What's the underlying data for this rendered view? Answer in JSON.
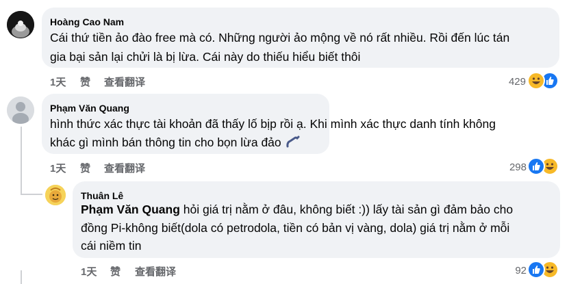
{
  "comments": [
    {
      "author": "Hoàng Cao Nam",
      "lines": [
        "Cái thứ tiền ảo đào free mà có. Những người ảo mộng về nó rất nhiều. Rồi đến lúc tán",
        "gia bại sản lại chửi là bị lừa. Cái này do thiếu hiểu biết thôi"
      ],
      "time": "1天",
      "like": "赞",
      "translate": "查看翻译",
      "reaction_count": "429"
    },
    {
      "author": "Phạm Văn Quang",
      "lines": [
        "hình thức xác thực tài khoản đã thấy lố bịp rồi ạ. Khi mình xác thực danh tính không",
        "khác gì mình bán thông tin cho bọn lừa đảo"
      ],
      "time": "1天",
      "like": "赞",
      "translate": "查看翻译",
      "reaction_count": "298"
    },
    {
      "author": "Thuân Lê",
      "mention": "Phạm Văn Quang",
      "lines": [
        " hỏi giá trị nằm ở đâu, không biết :)) lấy tài sản gì đảm bảo cho",
        "đồng Pi-không biết(dola có petrodola, tiền có bản vị vàng, dola) giá trị nằm ở mỗi",
        "cái niềm tin"
      ],
      "time": "1天",
      "like": "赞",
      "translate": "查看翻译",
      "reaction_count": "92"
    }
  ],
  "colors": {
    "bubble": "#f0f2f5",
    "secondary_text": "#65676b",
    "like_blue": "#1877f2",
    "haha_yellow": "#f7b928"
  },
  "icons": [
    "avatar-dark-photo",
    "avatar-default-person",
    "avatar-yellow-cartoon",
    "haha-reaction-icon",
    "like-reaction-icon"
  ]
}
